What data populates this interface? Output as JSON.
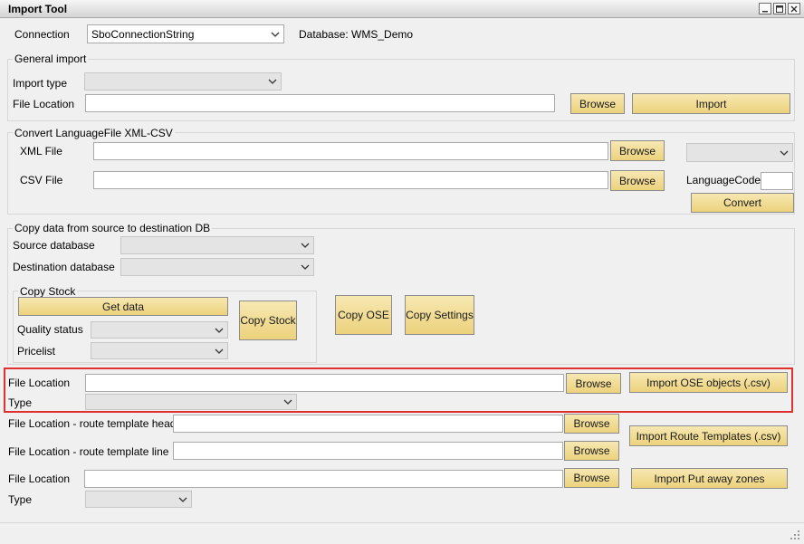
{
  "window": {
    "title": "Import Tool"
  },
  "connection": {
    "label": "Connection",
    "value": "SboConnectionString",
    "database_text": "Database: WMS_Demo"
  },
  "general_import": {
    "legend": "General import",
    "import_type_label": "Import type",
    "import_type_value": "",
    "file_location_label": "File Location",
    "browse": "Browse",
    "import": "Import"
  },
  "convert": {
    "legend": "Convert LanguageFile XML-CSV",
    "xml_label": "XML File",
    "csv_label": "CSV File",
    "browse": "Browse",
    "language_code_label": "LanguageCode:",
    "convert": "Convert"
  },
  "copy_data": {
    "legend": "Copy data from source to destination DB",
    "source_label": "Source database",
    "destination_label": "Destination database",
    "copy_stock": {
      "legend": "Copy Stock",
      "get_data": "Get data",
      "quality_label": "Quality status",
      "pricelist_label": "Pricelist",
      "copy_stock_button": "Copy Stock"
    },
    "copy_ose": "Copy OSE",
    "copy_settings": "Copy Settings"
  },
  "ose_import": {
    "file_location_label": "File Location",
    "type_label": "Type",
    "browse": "Browse",
    "import": "Import OSE objects (.csv)"
  },
  "route_templates": {
    "header_label": "File Location - route template header",
    "line_label": "File Location - route template line",
    "browse": "Browse",
    "import": "Import Route Templates (.csv)"
  },
  "putaway": {
    "file_location_label": "File Location",
    "type_label": "Type",
    "browse": "Browse",
    "import": "Import Put away zones"
  },
  "icons": [
    "minimize-icon",
    "maximize-icon",
    "close-icon",
    "chevron-down-icon",
    "resize-grip-icon"
  ],
  "colors": {
    "button_face": "#ecd27c",
    "highlight_border": "#e03131",
    "frame_border": "#d7d7d7"
  }
}
